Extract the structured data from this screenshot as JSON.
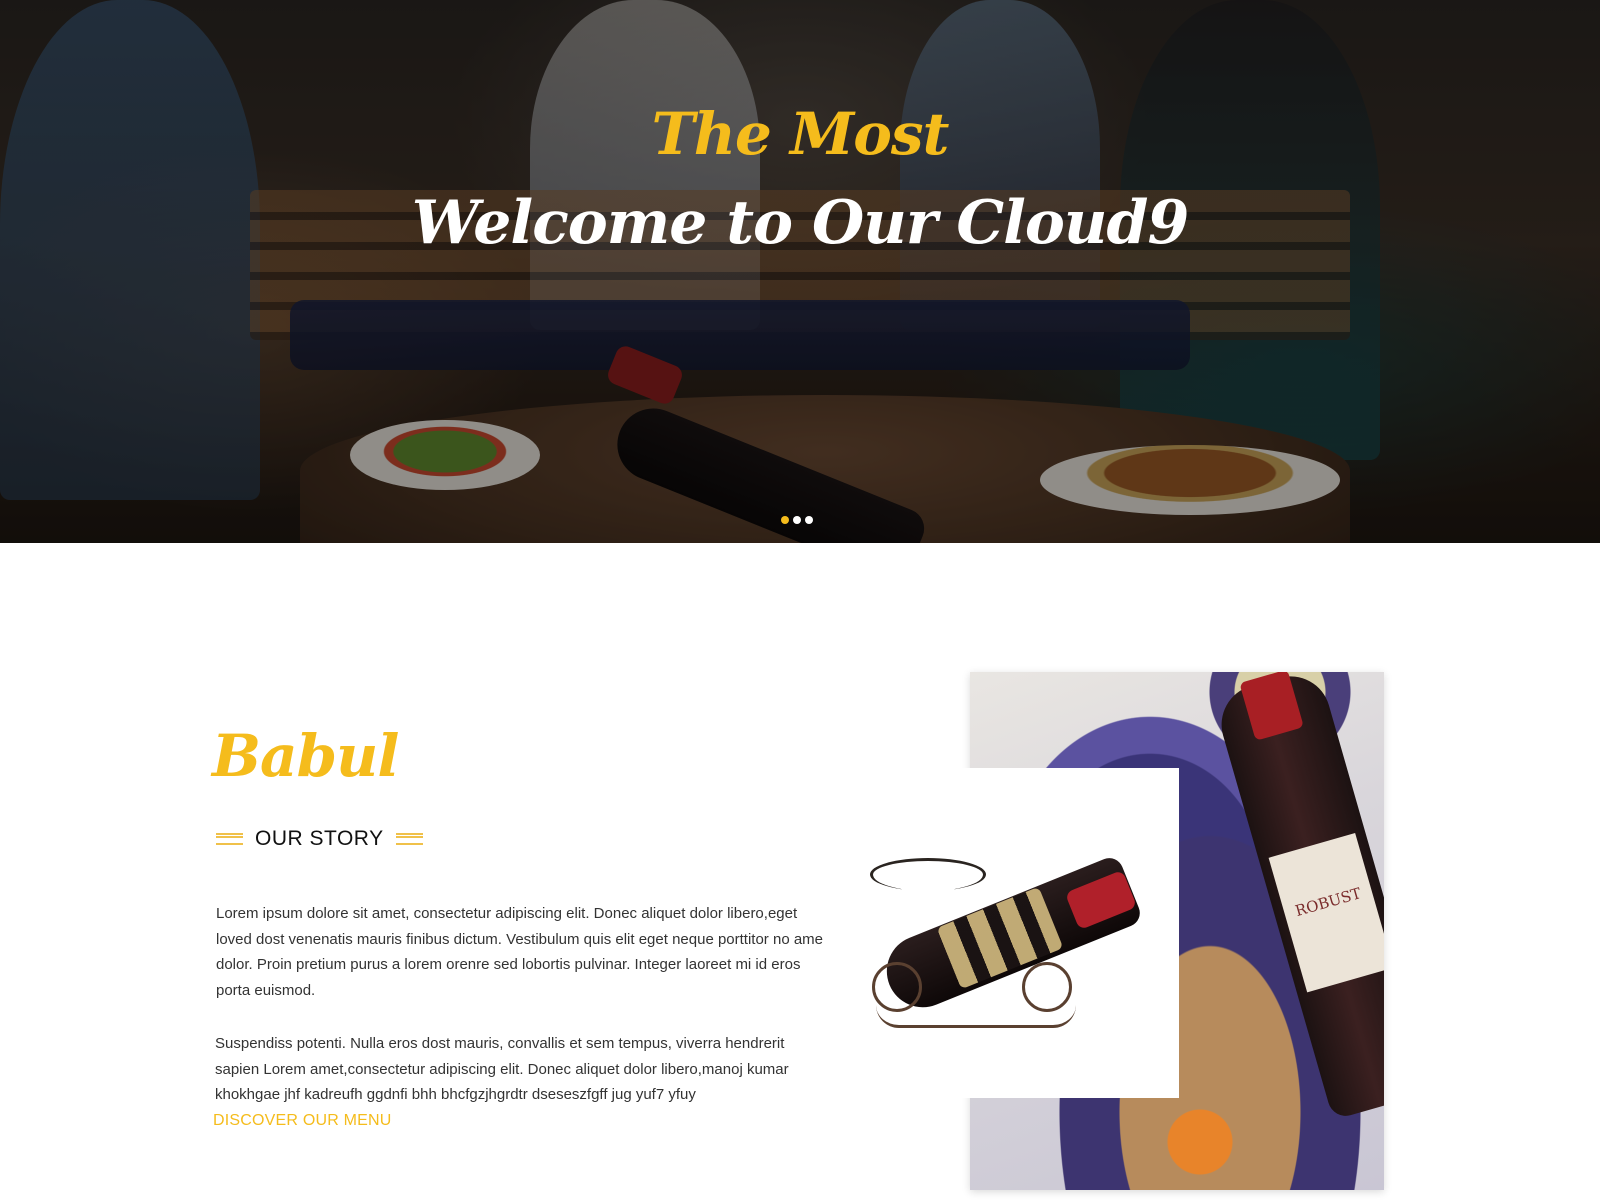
{
  "hero": {
    "title_top": "The Most",
    "title_main": "Welcome to Our Cloud9",
    "slider_dots": 3,
    "active_dot": 1,
    "accent_color": "#f5bc1c"
  },
  "story": {
    "brand": "Babul",
    "heading": "OUR STORY",
    "paragraph_1": "Lorem ipsum dolore sit amet, consectetur adipiscing elit. Donec aliquet dolor libero,eget loved dost venenatis mauris finibus dictum. Vestibulum quis elit eget neque porttitor no ame dolor. Proin pretium purus a lorem orenre sed lobortis pulvinar. Integer laoreet mi id eros porta euismod.",
    "paragraph_2": "Suspendiss potenti. Nulla eros dost mauris, convallis et sem tempus, viverra hendrerit sapien Lorem amet,consectetur adipiscing elit. Donec aliquet dolor libero,manoj kumar khokhgae jhf kadreufh ggdnfi bhh bhcfgzjhgrdtr dseseszfgff jug yuf7 yfuy",
    "discover_link": "DISCOVER OUR MENU"
  },
  "collage": {
    "wine_label": "ROBUST"
  }
}
